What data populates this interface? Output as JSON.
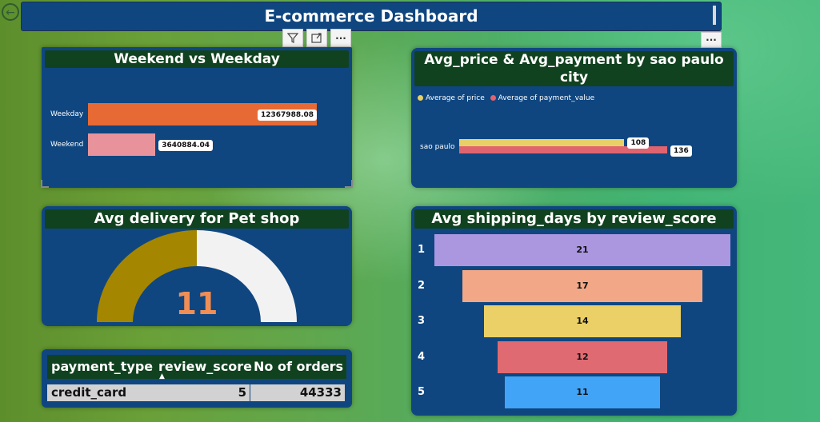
{
  "header": {
    "title": "E-commerce Dashboard"
  },
  "toolbar": {
    "more_label": "···"
  },
  "colors": {
    "panel": "#0f4680",
    "title_bg": "#11421f",
    "weekday": "#e76a35",
    "weekend": "#e8939b",
    "price": "#e9d066",
    "payment": "#e0646f",
    "gauge_fill": "#a48600",
    "gauge_rest": "#f2f2f2",
    "gauge_value": "#f08e55",
    "funnel": [
      "#ab96e0",
      "#f2a886",
      "#ead066",
      "#e06a72",
      "#41a4f6"
    ]
  },
  "charts": {
    "weekend": {
      "title": "Weekend vs Weekday",
      "categories": [
        "Weekday",
        "Weekend"
      ],
      "value_labels": [
        "12367988.08",
        "3640884.04"
      ]
    },
    "saopaulo": {
      "title": "Avg_price & Avg_payment by sao paulo city",
      "legend": [
        "Average of price",
        "Average of payment_value"
      ],
      "category": "sao paulo",
      "value_labels": [
        "108",
        "136"
      ]
    },
    "gauge": {
      "title": "Avg delivery for Pet shop",
      "value_label": "11"
    },
    "funnel": {
      "title": "Avg shipping_days by review_score",
      "categories": [
        "1",
        "2",
        "3",
        "4",
        "5"
      ],
      "value_labels": [
        "21",
        "17",
        "14",
        "12",
        "11"
      ]
    }
  },
  "table": {
    "headers": [
      "payment_type",
      "review_score",
      "No of orders"
    ],
    "row": [
      "credit_card",
      "5",
      "44333"
    ]
  },
  "chart_data": [
    {
      "type": "bar",
      "title": "Weekend vs Weekday",
      "categories": [
        "Weekday",
        "Weekend"
      ],
      "values": [
        12367988.08,
        3640884.04
      ]
    },
    {
      "type": "bar",
      "title": "Avg_price & Avg_payment by sao paulo city",
      "categories": [
        "sao paulo"
      ],
      "series": [
        {
          "name": "Average of price",
          "values": [
            108
          ]
        },
        {
          "name": "Average of payment_value",
          "values": [
            136
          ]
        }
      ],
      "legend": "top-left"
    },
    {
      "type": "gauge",
      "title": "Avg delivery for Pet shop",
      "value": 11,
      "fraction_filled": 0.5
    },
    {
      "type": "bar",
      "title": "Avg shipping_days by review_score",
      "categories": [
        "1",
        "2",
        "3",
        "4",
        "5"
      ],
      "values": [
        21,
        17,
        14,
        12,
        11
      ]
    },
    {
      "type": "table",
      "columns": [
        "payment_type",
        "review_score",
        "No of orders"
      ],
      "rows": [
        [
          "credit_card",
          "5",
          "44333"
        ]
      ]
    }
  ]
}
